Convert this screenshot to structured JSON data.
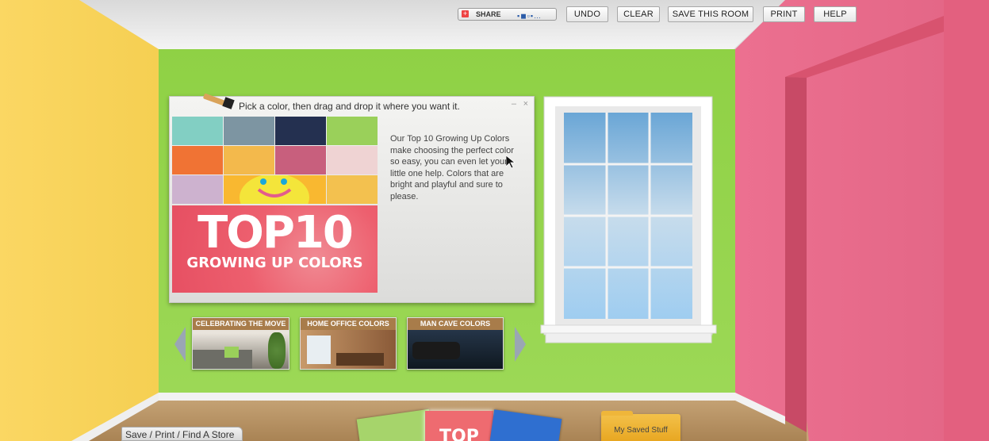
{
  "toolbar": {
    "share_label": "SHARE",
    "undo_label": "UNDO",
    "clear_label": "CLEAR",
    "save_room_label": "SAVE THIS ROOM",
    "print_label": "PRINT",
    "help_label": "HELP"
  },
  "palette_panel": {
    "instruction": "Pick a color, then drag and drop it where you want it.",
    "minimize_label": "–",
    "close_label": "×",
    "swatches": [
      "#82cfc3",
      "#7d95a2",
      "#243050",
      "#9ad05a",
      "#f07334",
      "#f3b94c",
      "#c85f7d",
      "#efd3d3",
      "#cdb2cf",
      "#f3c14f"
    ],
    "promo_title": "TOP10",
    "promo_subtitle": "GROWING UP COLORS",
    "description": "Our Top 10 Growing Up Colors make choosing the perfect color so easy, you can even let your little one help. Colors that are bright and playful and sure to please."
  },
  "collections": [
    {
      "label": "CELEBRATING THE MOVE"
    },
    {
      "label": "HOME OFFICE  COLORS"
    },
    {
      "label": "MAN CAVE COLORS"
    }
  ],
  "footer": {
    "save_print_store": "Save / Print / Find A Store",
    "my_saved_stuff": "My Saved Stuff",
    "card_top_label": "TOP"
  },
  "colors": {
    "left_wall": "#f8d45c",
    "back_wall": "#97d64a",
    "right_wall": "#e86a8a",
    "far_wall": "#f47a2e",
    "ceiling": "#e9e9e9"
  }
}
